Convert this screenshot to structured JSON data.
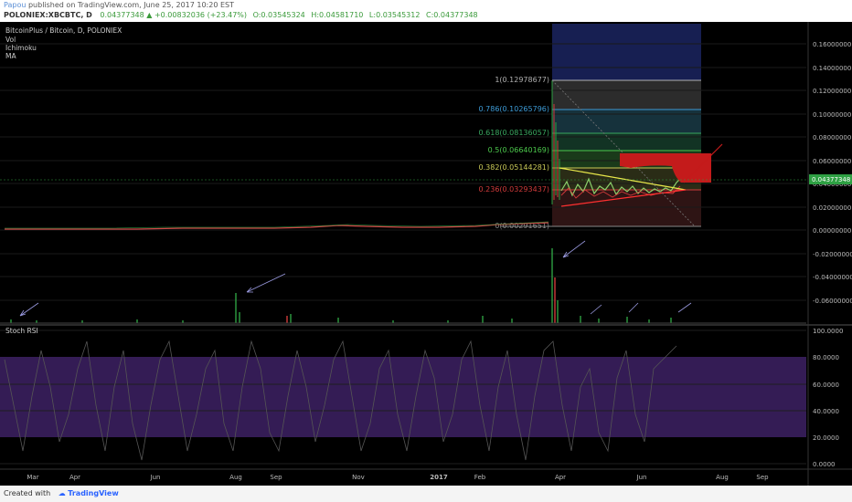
{
  "header": {
    "author": "Papou",
    "published": "published on TradingView.com, June 25, 2017 10:20 EST",
    "symbol": "POLONIEX:XBCBTC, D",
    "last": "0.04377348",
    "change": "+0.00832036 (+23.47%)",
    "o": "O:0.03545324",
    "h": "H:0.04581710",
    "l": "L:0.03545312",
    "c": "C:0.04377348"
  },
  "legend": {
    "title": "BitcoinPlus / Bitcoin, D, POLONIEX",
    "items": [
      "Vol",
      "Ichimoku",
      "MA"
    ]
  },
  "stoch_label": "Stoch RSI",
  "footer": {
    "created": "Created with",
    "brand": "TradingView"
  },
  "colors": {
    "up": "#2ea043",
    "down": "#d13b3b",
    "rsi_band": "#3a1f5e",
    "fib_up": "#1b2b60"
  },
  "chart_data": [
    {
      "type": "line",
      "title": "BitcoinPlus / Bitcoin, D, POLONIEX",
      "price_axis": {
        "min": -0.02,
        "max": 0.17,
        "ticks": [
          "0.16000000",
          "0.14000000",
          "0.12000000",
          "0.10000000",
          "0.08000000",
          "0.06000000",
          "0.04000000",
          "0.02000000",
          "0.00000000",
          "-0.02000000",
          "-0.04000000",
          "-0.06000000"
        ]
      },
      "last_price": "0.04377348",
      "x_ticks": [
        "Mar",
        "Apr",
        "Jun",
        "Aug",
        "Sep",
        "Nov",
        "2017",
        "Feb",
        "Apr",
        "Jun",
        "Aug",
        "Sep"
      ],
      "fib_levels": [
        {
          "ratio": "1(0.12978677)",
          "value": 0.12978677,
          "color": "#b0b0b0"
        },
        {
          "ratio": "0.786(0.10265796)",
          "value": 0.10265796,
          "color": "#3d9bd6"
        },
        {
          "ratio": "0.618(0.08136057)",
          "value": 0.08136057,
          "color": "#3aa860"
        },
        {
          "ratio": "0.5(0.06640169)",
          "value": 0.06640169,
          "color": "#4cc94c"
        },
        {
          "ratio": "0.382(0.05144281)",
          "value": 0.05144281,
          "color": "#c9c957"
        },
        {
          "ratio": "0.236(0.03293437)",
          "value": 0.03293437,
          "color": "#d13b3b"
        },
        {
          "ratio": "0(0.00291651)",
          "value": 0.00291651,
          "color": "#888888"
        }
      ]
    },
    {
      "type": "line",
      "title": "Stoch RSI",
      "ylim": [
        0,
        100
      ],
      "ticks": [
        "100.0000",
        "80.0000",
        "60.0000",
        "40.0000",
        "20.0000",
        "0.0000"
      ],
      "band": [
        20,
        80
      ]
    }
  ]
}
